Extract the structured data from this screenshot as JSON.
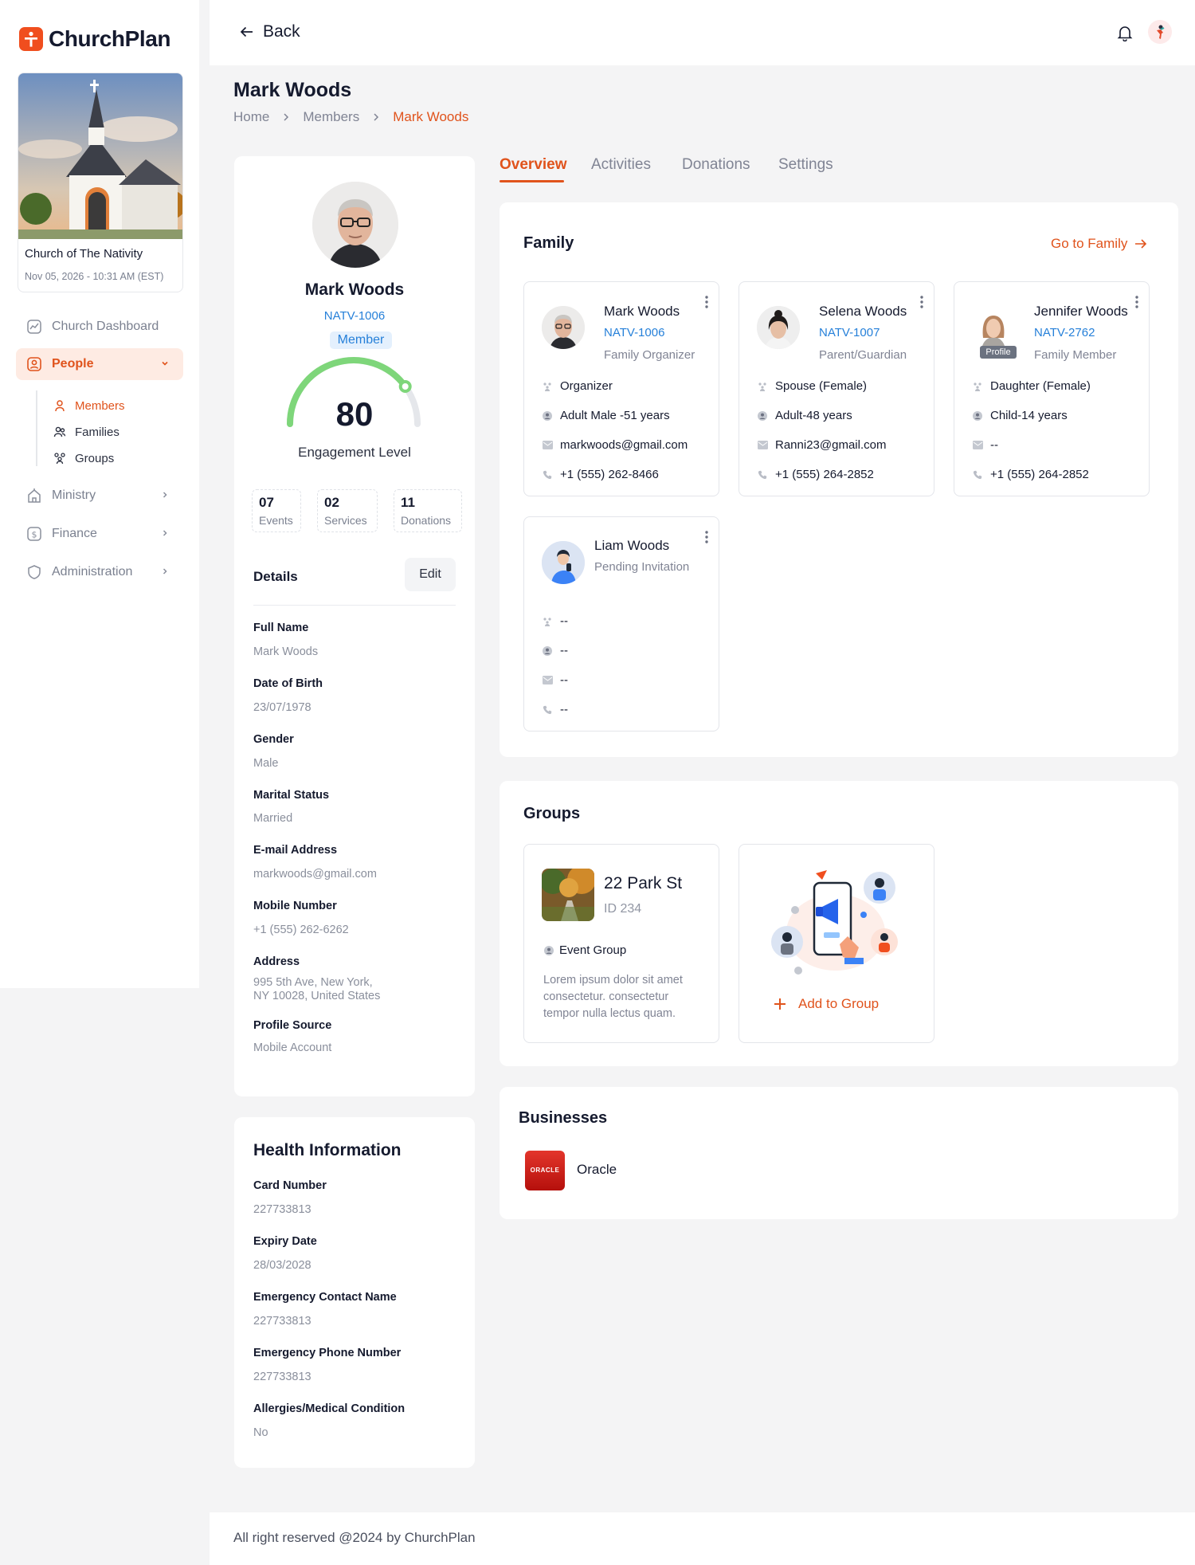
{
  "app": {
    "name": "ChurchPlan"
  },
  "church": {
    "name": "Church of The Nativity",
    "date": "Nov 05, 2026 - 10:31 AM (EST)"
  },
  "sidebar": {
    "nav": [
      {
        "label": "Church Dashboard",
        "icon": "dashboard-icon"
      },
      {
        "label": "People",
        "icon": "people-icon",
        "active": true,
        "expanded": true
      },
      {
        "label": "Ministry",
        "icon": "ministry-icon"
      },
      {
        "label": "Finance",
        "icon": "finance-icon"
      },
      {
        "label": "Administration",
        "icon": "shield-icon"
      }
    ],
    "people_sub": [
      {
        "label": "Members",
        "icon": "member-icon",
        "active": true
      },
      {
        "label": "Families",
        "icon": "families-icon"
      },
      {
        "label": "Groups",
        "icon": "groups-icon"
      }
    ]
  },
  "topbar": {
    "back_label": "Back"
  },
  "header": {
    "title": "Mark Woods",
    "breadcrumb": [
      "Home",
      "Members",
      "Mark Woods"
    ]
  },
  "profile": {
    "name": "Mark Woods",
    "id": "NATV-1006",
    "badge": "Member",
    "engagement_value": "80",
    "engagement_score": 80,
    "engagement_label": "Engagement Level",
    "stats": [
      {
        "value": "07",
        "label": "Events"
      },
      {
        "value": "02",
        "label": "Services"
      },
      {
        "value": "11",
        "label": "Donations"
      }
    ],
    "details_title": "Details",
    "edit_label": "Edit",
    "fields": [
      {
        "label": "Full Name",
        "value": "Mark Woods"
      },
      {
        "label": "Date of Birth",
        "value": "23/07/1978"
      },
      {
        "label": "Gender",
        "value": "Male"
      },
      {
        "label": "Marital Status",
        "value": "Married"
      },
      {
        "label": "E-mail Address",
        "value": "markwoods@gmail.com"
      },
      {
        "label": "Mobile Number",
        "value": "+1 (555) 262-6262"
      },
      {
        "label": "Address",
        "value_line1": "995 5th Ave, New York,",
        "value_line2": "NY 10028, United States"
      },
      {
        "label": "Profile Source",
        "value": "Mobile Account"
      }
    ]
  },
  "health": {
    "title": "Health Information",
    "fields": [
      {
        "label": "Card Number",
        "value": "227733813"
      },
      {
        "label": "Expiry Date",
        "value": "28/03/2028"
      },
      {
        "label": "Emergency Contact Name",
        "value": "227733813"
      },
      {
        "label": "Emergency Phone Number",
        "value": "227733813"
      },
      {
        "label": "Allergies/Medical Condition",
        "value": "No"
      }
    ]
  },
  "tabs": [
    {
      "label": "Overview",
      "active": true
    },
    {
      "label": "Activities"
    },
    {
      "label": "Donations"
    },
    {
      "label": "Settings"
    }
  ],
  "family": {
    "title": "Family",
    "goto_label": "Go to Family",
    "members": [
      {
        "name": "Mark Woods",
        "id": "NATV-1006",
        "role": "Family Organizer",
        "relation": "Organizer",
        "age": "Adult Male -51 years",
        "email": "markwoods@gmail.com",
        "phone": "+1 (555) 262-8466"
      },
      {
        "name": "Selena Woods",
        "id": "NATV-1007",
        "role": "Parent/Guardian",
        "relation": "Spouse (Female)",
        "age": "Adult-48 years",
        "email": "Ranni23@gmail.com",
        "phone": "+1 (555) 264-2852"
      },
      {
        "name": "Jennifer Woods",
        "id": "NATV-2762",
        "role": "Family Member",
        "relation": "Daughter (Female)",
        "age": "Child-14 years",
        "email": "--",
        "phone": "+1 (555) 264-2852",
        "chip": "Profile"
      },
      {
        "name": "Liam Woods",
        "role": "Pending Invitation",
        "relation": "--",
        "age": "--",
        "email": "--",
        "phone": "--"
      }
    ]
  },
  "groups": {
    "title": "Groups",
    "items": [
      {
        "name": "22 Park St",
        "id": "ID 234",
        "type": "Event Group",
        "desc": "Lorem ipsum dolor sit amet consectetur. consectetur tempor nulla lectus quam."
      }
    ],
    "add_label": "Add to Group"
  },
  "businesses": {
    "title": "Businesses",
    "items": [
      {
        "name": "Oracle",
        "logo_text": "ORACLE"
      }
    ]
  },
  "footer": {
    "text": "All right reserved @2024 by ChurchPlan"
  },
  "colors": {
    "accent": "#e0531c",
    "link": "#2680d9",
    "gauge": "#7ed67a"
  }
}
